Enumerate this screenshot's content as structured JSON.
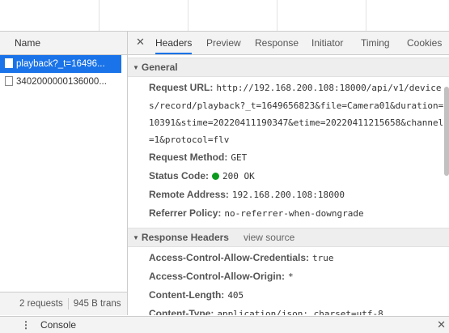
{
  "left_panel": {
    "header": "Name",
    "rows": [
      {
        "name": "playback?_t=16496..."
      },
      {
        "name": "3402000000136000..."
      }
    ],
    "footer": {
      "requests": "2 requests",
      "transfer": "945 B trans"
    }
  },
  "tabs": [
    "Headers",
    "Preview",
    "Response",
    "Initiator",
    "Timing",
    "Cookies"
  ],
  "general": {
    "title": "General",
    "request_url_key": "Request URL:",
    "request_url_lines": [
      "http://192.168.200.108:18000/api/v1/device",
      "s/record/playback?_t=1649656823&file=Camera01&duration=",
      "10391&stime=20220411190347&etime=20220411215658&channel",
      "=1&protocol=flv"
    ],
    "request_method_key": "Request Method:",
    "request_method": "GET",
    "status_code_key": "Status Code:",
    "status_code": "200 OK",
    "status_color": "#0c9a1e",
    "remote_address_key": "Remote Address:",
    "remote_address": "192.168.200.108:18000",
    "referrer_policy_key": "Referrer Policy:",
    "referrer_policy": "no-referrer-when-downgrade"
  },
  "response_headers": {
    "title": "Response Headers",
    "view_source": "view source",
    "items": [
      {
        "key": "Access-Control-Allow-Credentials:",
        "value": "true"
      },
      {
        "key": "Access-Control-Allow-Origin:",
        "value": "*"
      },
      {
        "key": "Content-Length:",
        "value": "405"
      },
      {
        "key": "Content-Type:",
        "value": "application/json; charset=utf-8"
      }
    ]
  },
  "console": {
    "label": "Console",
    "menu_icon": "kebab-menu-icon",
    "close_icon": "close-icon"
  },
  "accent_color": "#1a73e8"
}
